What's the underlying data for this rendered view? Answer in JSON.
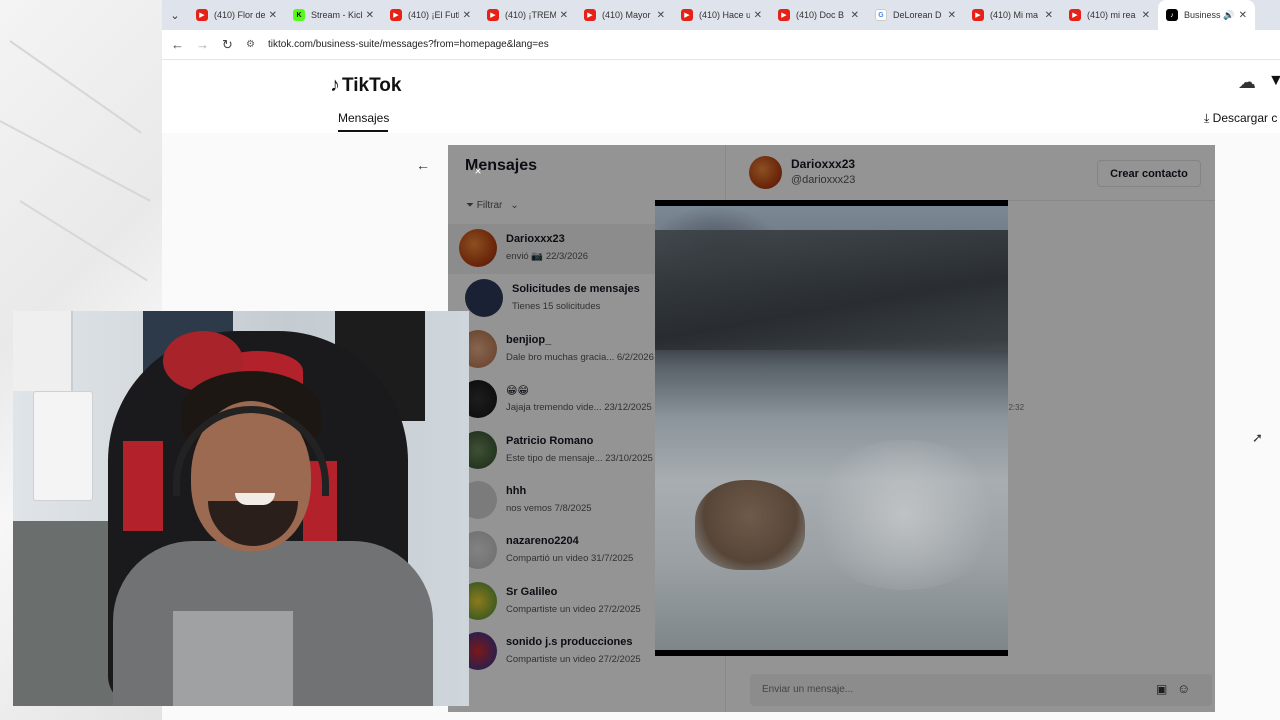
{
  "browser": {
    "tabs": [
      {
        "title": "(410) Flor de",
        "favicon": "youtube-icon",
        "active": false
      },
      {
        "title": "Stream - Kick",
        "favicon": "kick-icon",
        "active": false
      },
      {
        "title": "(410) ¡El Futb",
        "favicon": "youtube-icon",
        "active": false
      },
      {
        "title": "(410) ¡TREME",
        "favicon": "youtube-icon",
        "active": false
      },
      {
        "title": "(410) Mayor",
        "favicon": "youtube-icon",
        "active": false
      },
      {
        "title": "(410) Hace u",
        "favicon": "youtube-icon",
        "active": false
      },
      {
        "title": "(410) Doc B",
        "favicon": "youtube-icon",
        "active": false
      },
      {
        "title": "DeLorean D",
        "favicon": "google-icon",
        "active": false
      },
      {
        "title": "(410) Mi ma",
        "favicon": "youtube-icon",
        "active": false
      },
      {
        "title": "(410) mi rea",
        "favicon": "youtube-icon",
        "active": false
      },
      {
        "title": "Business",
        "favicon": "tiktok-icon",
        "active": true
      }
    ],
    "url": "tiktok.com/business-suite/messages?from=homepage&lang=es"
  },
  "tiktok": {
    "logo_text": "TikTok",
    "nav_tab": "Mensajes",
    "download_label": "Descargar c"
  },
  "messages": {
    "title": "Mensajes",
    "filter_label": "Filtrar",
    "conversations": [
      {
        "name": "Darioxxx23",
        "subtitle": "envió 📷 22/3/2026",
        "selected": true
      },
      {
        "name": "Solicitudes de mensajes",
        "subtitle": "Tienes 15 solicitudes",
        "selected": false
      },
      {
        "name": "benjiop_",
        "subtitle": "Dale bro muchas gracia... 6/2/2026",
        "selected": false
      },
      {
        "name": "😁😁",
        "subtitle": "Jajaja tremendo vide... 23/12/2025",
        "selected": false
      },
      {
        "name": "Patricio Romano",
        "subtitle": "Este tipo de mensaje... 23/10/2025",
        "selected": false
      },
      {
        "name": "hhh",
        "subtitle": "nos vemos 7/8/2025",
        "selected": false
      },
      {
        "name": "nazareno2204",
        "subtitle": "Compartió un video 31/7/2025",
        "selected": false
      },
      {
        "name": "Sr Galileo",
        "subtitle": "Compartiste un video 27/2/2025",
        "selected": false
      },
      {
        "name": "sonido j.s producciones",
        "subtitle": "Compartiste un video 27/2/2025",
        "selected": false
      }
    ]
  },
  "chat": {
    "name": "Darioxxx23",
    "handle": "@darioxxx23",
    "create_contact_label": "Crear contacto",
    "time": "22:32",
    "input_placeholder": "Enviar un mensaje..."
  },
  "overlay": {
    "close_symbol": "×"
  }
}
